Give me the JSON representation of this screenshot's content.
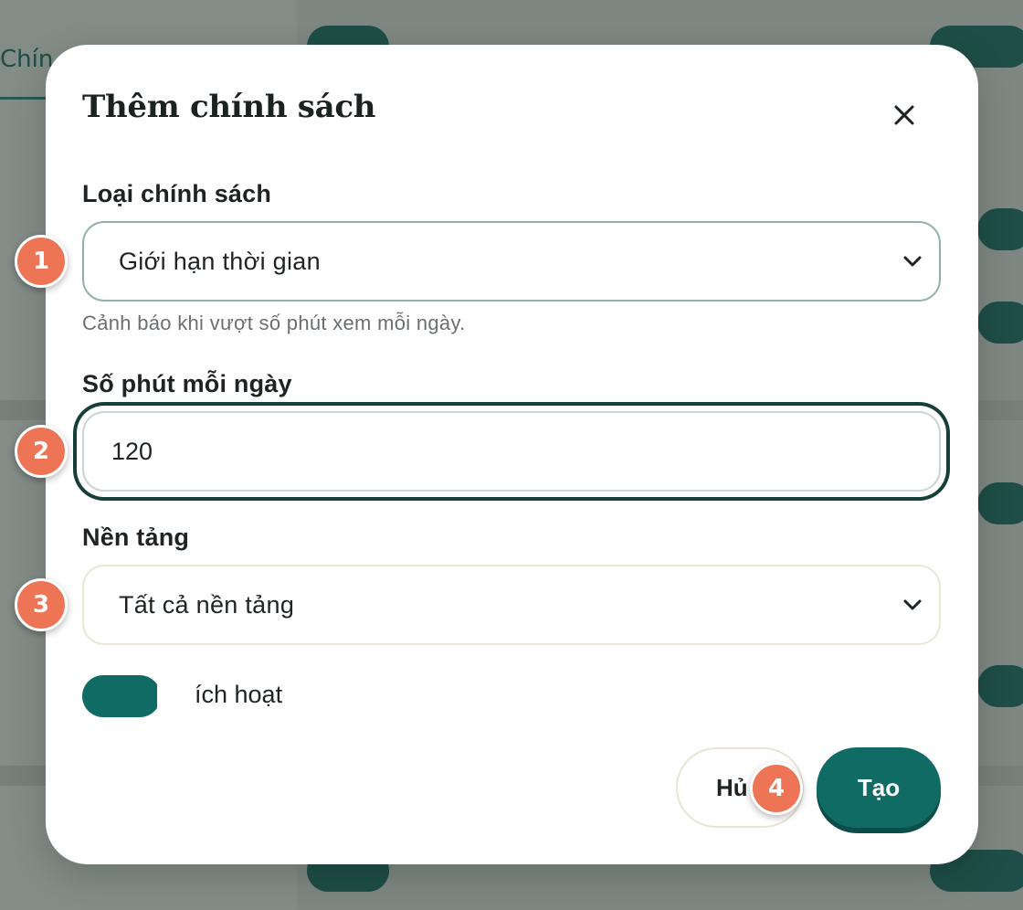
{
  "background": {
    "tab_label": "Chín"
  },
  "dialog": {
    "title": "Thêm chính sách",
    "close_label": "×"
  },
  "fields": {
    "policy_type": {
      "label": "Loại chính sách",
      "value": "Giới hạn thời gian",
      "hint": "Cảnh báo khi vượt số phút xem mỗi ngày."
    },
    "minutes_per_day": {
      "label": "Số phút mỗi ngày",
      "value": "120"
    },
    "platform": {
      "label": "Nền tảng",
      "value": "Tất cả nền tảng"
    },
    "active_toggle": {
      "label": "ích hoạt",
      "on": true
    }
  },
  "actions": {
    "cancel_label": "Hủ",
    "create_label": "Tạo"
  },
  "markers": [
    "1",
    "2",
    "3",
    "4"
  ],
  "colors": {
    "accent": "#106b64",
    "marker": "#ee7456",
    "focus_ring": "#163f3a"
  },
  "icons": {
    "close": "close-icon",
    "select_chevron": "chevron-down-icon"
  }
}
